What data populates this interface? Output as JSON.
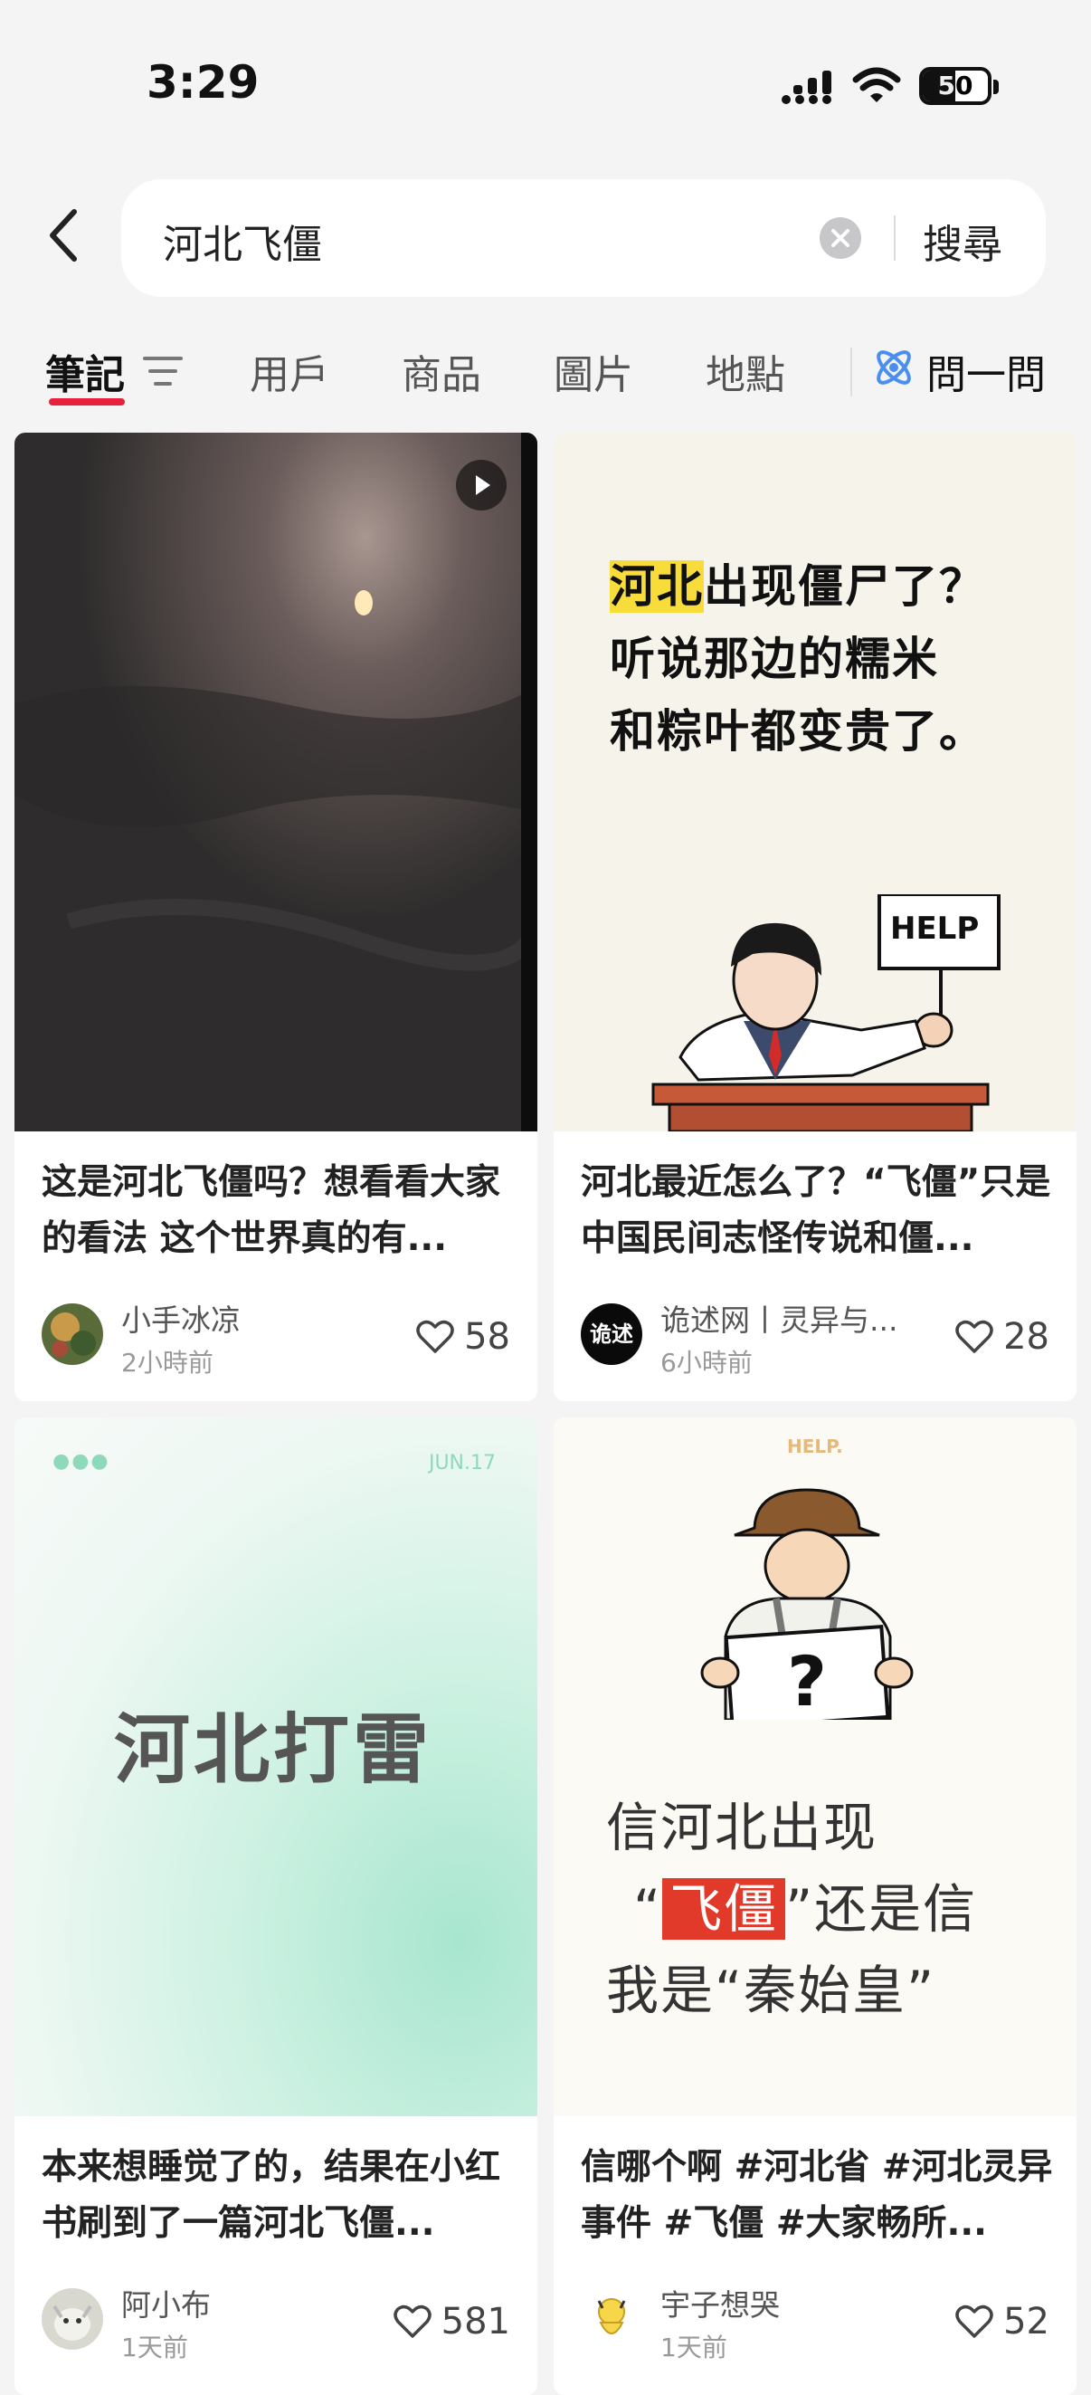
{
  "status": {
    "time": "3:29",
    "battery": "50",
    "battery_level": 0.5
  },
  "search": {
    "query": "河北飞僵",
    "button": "搜尋"
  },
  "tabs": {
    "notes": "筆記",
    "users": "用戶",
    "products": "商品",
    "images": "圖片",
    "places": "地點",
    "ask": "問一問"
  },
  "cards": [
    {
      "title": "这是河北飞僵吗？想看看大家的看法 这个世界真的有...",
      "author": "小手冰凉",
      "time": "2小時前",
      "likes": "58"
    },
    {
      "image_text": [
        "河北",
        "出现僵尸了？",
        "听说那边的糯米",
        "和粽叶都变贵了。"
      ],
      "sign": "HELP",
      "title": "河北最近怎么了？“飞僵”只是中国民间志怪传说和僵...",
      "author": "诡述网丨灵异与...",
      "avatar_text": "诡述",
      "time": "6小時前",
      "likes": "28"
    },
    {
      "image_date": "JUN.17",
      "image_text": "河北打雷",
      "title": "本来想睡觉了的，结果在小红书刷到了一篇河北飞僵...",
      "author": "阿小布",
      "time": "1天前",
      "likes": "581"
    },
    {
      "image_top": "HELP.",
      "image_lines": [
        "信河北出现",
        "“",
        "飞僵",
        "”还是信",
        "我是“秦始皇”"
      ],
      "title": "信哪个啊 #河北省 #河北灵异事件 #飞僵 #大家畅所...",
      "author": "宇子想哭",
      "time": "1天前",
      "likes": "52"
    }
  ]
}
